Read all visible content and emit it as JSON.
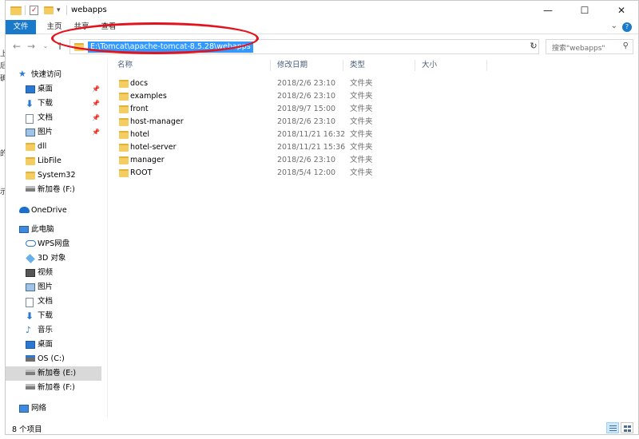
{
  "window": {
    "title": "webapps",
    "minimize_glyph": "—",
    "maximize_glyph": "☐",
    "close_glyph": "✕"
  },
  "ribbon": {
    "tabs": [
      "文件",
      "主页",
      "共享",
      "查看"
    ]
  },
  "address": {
    "path": "E:\\Tomcat\\apache-tomcat-8.5.28\\webapps",
    "search_placeholder": "搜索\"webapps\""
  },
  "columns": {
    "name": "名称",
    "date": "修改日期",
    "type": "类型",
    "size": "大小"
  },
  "files": [
    {
      "name": "docs",
      "date": "2018/2/6 23:10",
      "type": "文件夹"
    },
    {
      "name": "examples",
      "date": "2018/2/6 23:10",
      "type": "文件夹"
    },
    {
      "name": "front",
      "date": "2018/9/7 15:00",
      "type": "文件夹"
    },
    {
      "name": "host-manager",
      "date": "2018/2/6 23:10",
      "type": "文件夹"
    },
    {
      "name": "hotel",
      "date": "2018/11/21 16:32",
      "type": "文件夹"
    },
    {
      "name": "hotel-server",
      "date": "2018/11/21 15:36",
      "type": "文件夹"
    },
    {
      "name": "manager",
      "date": "2018/2/6 23:10",
      "type": "文件夹"
    },
    {
      "name": "ROOT",
      "date": "2018/5/4 12:00",
      "type": "文件夹"
    }
  ],
  "nav": {
    "quick_access": "快速访问",
    "quick_items": [
      "桌面",
      "下载",
      "文档",
      "图片",
      "dll",
      "LibFile",
      "System32",
      "新加卷 (F:)"
    ],
    "onedrive": "OneDrive",
    "this_pc": "此电脑",
    "pc_items": [
      "WPS网盘",
      "3D 对象",
      "视频",
      "图片",
      "文档",
      "下载",
      "音乐",
      "桌面",
      "OS (C:)",
      "新加卷 (E:)",
      "新加卷 (F:)"
    ],
    "network": "网络"
  },
  "status": {
    "count": "8 个项目"
  },
  "colors": {
    "file_tab": "#1979ca",
    "selection": "#3399ff",
    "annotation": "#e4121d",
    "folder": "#f4cc5f"
  }
}
